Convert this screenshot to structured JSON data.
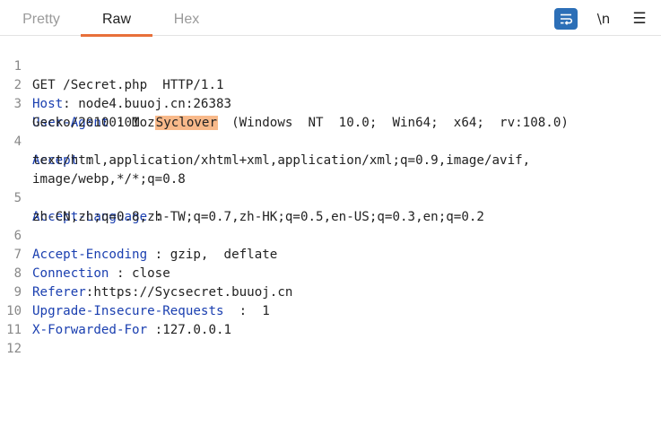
{
  "tabs": [
    {
      "label": "Pretty"
    },
    {
      "label": "Raw"
    },
    {
      "label": "Hex"
    }
  ],
  "toolbar": {
    "wrap_icon": "word-wrap-icon",
    "newline_label": "\\n",
    "menu_icon": "hamburger-menu-icon"
  },
  "colors": {
    "accent": "#e8703a",
    "header_name": "#1a3fb0",
    "highlight": "#f8b98a",
    "wrap_button": "#2c6fb7"
  },
  "request": {
    "line1": "GET /Secret.php  HTTP/1.1",
    "host_name": "Host",
    "host_sep": ": ",
    "host_value": "node4.buuoj.cn:26383",
    "ua_name": "User-Agent",
    "ua_sep": " : ",
    "ua_value1": "Mozilla/5.0  (Windows  NT  10.0;  Win64;  x64;  rv:108.0)",
    "ua_value2": "Gecko/20100101  ",
    "ua_highlight": "Syclover",
    "accept_name": "Accept",
    "accept_sep": " :",
    "accept_value1": "text/html,application/xhtml+xml,application/xml;q=0.9,image/avif,",
    "accept_value2": "image/webp,*/*;q=0.8",
    "al_name": "Accept-Language",
    "al_sep": " :",
    "al_value": "zh-CN,zh;q=0.8,zh-TW;q=0.7,zh-HK;q=0.5,en-US;q=0.3,en;q=0.2",
    "ae_name": "Accept-Encoding",
    "ae_sep": " : ",
    "ae_value": "gzip,  deflate",
    "conn_name": "Connection",
    "conn_sep": " : ",
    "conn_value": "close",
    "ref_name": "Referer",
    "ref_sep": ":",
    "ref_value": "https://Sycsecret.buuoj.cn",
    "uir_name": "Upgrade-Insecure-Requests",
    "uir_sep": "  :  ",
    "uir_value": "1",
    "xff_name": "X-Forwarded-For",
    "xff_sep": " :",
    "xff_value": "127.0.0.1"
  },
  "line_numbers": [
    "1",
    "2",
    "3",
    "4",
    "5",
    "6",
    "7",
    "8",
    "9",
    "10",
    "11",
    "12"
  ]
}
